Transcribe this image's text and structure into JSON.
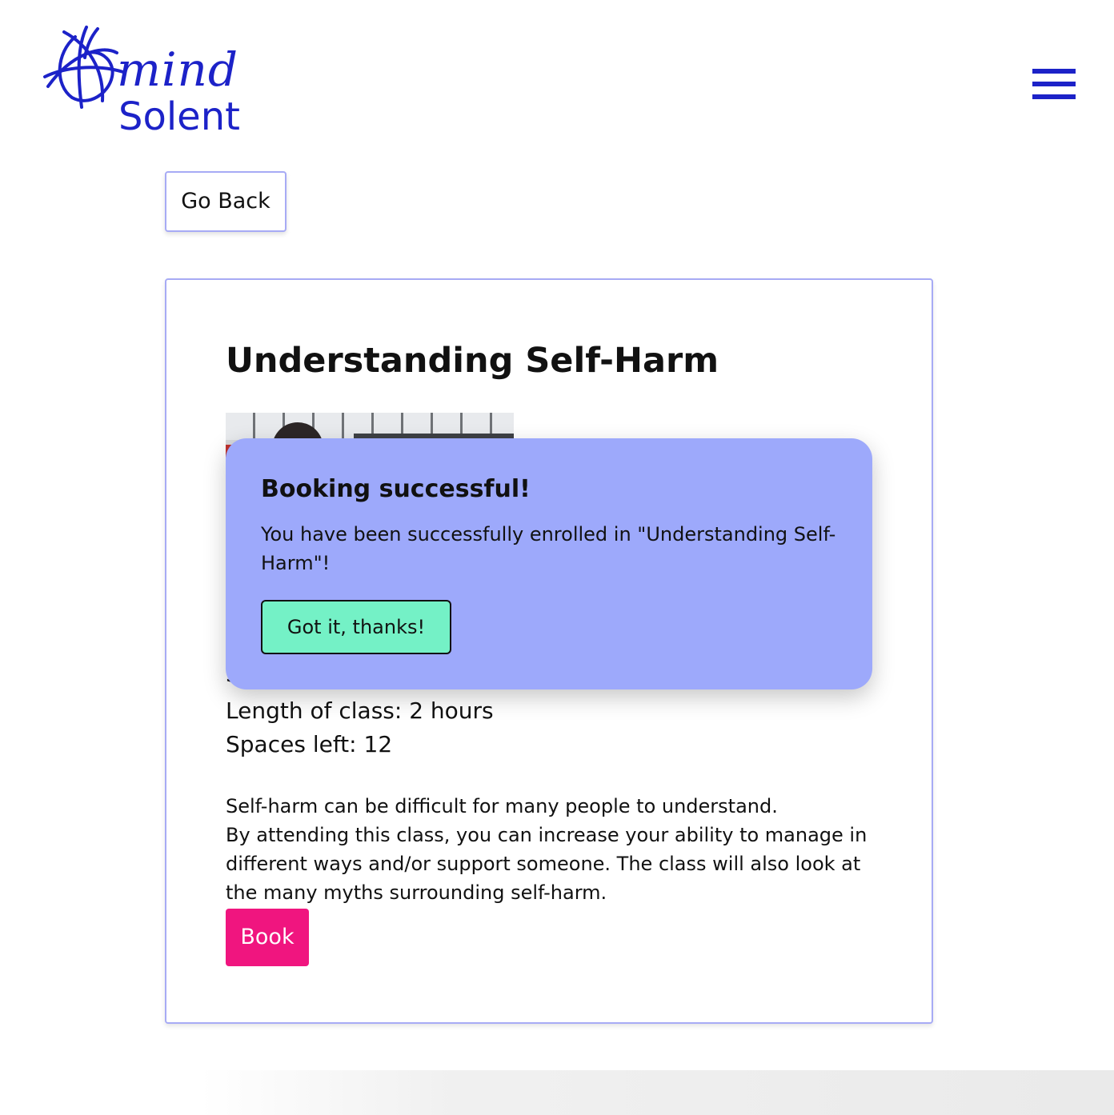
{
  "header": {
    "logo": {
      "mind_text": "mind",
      "solent_text": "Solent",
      "brand_color": "#1c22c8"
    },
    "menu_icon": "hamburger-menu-icon"
  },
  "navigation": {
    "go_back_label": "Go Back"
  },
  "class": {
    "title": "Understanding Self-Harm",
    "image_icon": "class-photo",
    "length_of_class": "Length of class: 2 hours",
    "spaces_left": "Spaces left: 12",
    "description": [
      "Self-harm can be difficult for many people to understand.",
      "By attending this class, you can increase your ability to manage in different ways and/or support someone. The class will also look at the many myths surrounding self-harm."
    ],
    "book_label": "Book",
    "book_color": "#f0157f"
  },
  "modal": {
    "title": "Booking successful!",
    "message": "You have been successfully enrolled in \"Understanding Self-Harm\"!",
    "confirm_label": "Got it, thanks!",
    "background_color": "#9da9fb",
    "confirm_color": "#74f1c6"
  }
}
